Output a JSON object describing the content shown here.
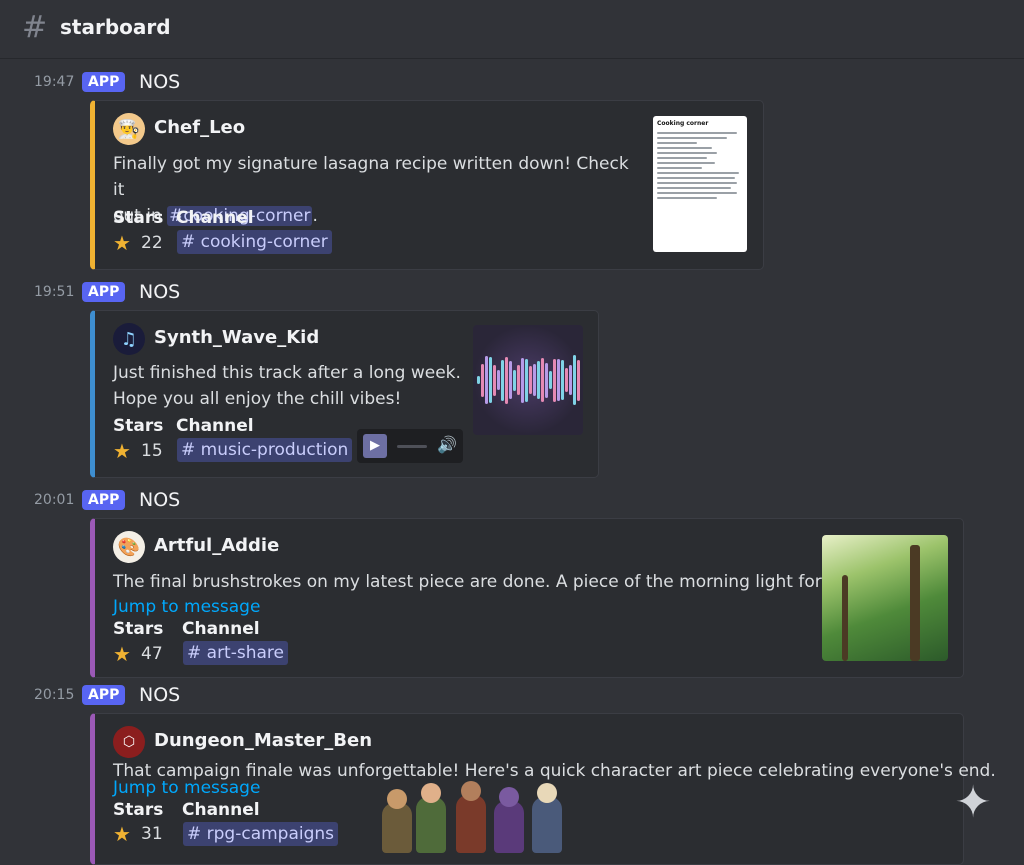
{
  "channel": {
    "name": "starboard"
  },
  "messages": [
    {
      "time": "19:47",
      "badge": "APP",
      "author": "NOS",
      "embed": {
        "username": "Chef_Leo",
        "text_before": "Finally got my signature lasagna recipe written down! Check it",
        "text_out_in": "out in",
        "mention": "#cooking-corner",
        "text_after": ".",
        "stars_label": "Stars",
        "channel_label": "Channel",
        "stars": "22",
        "channel": "# cooking-corner",
        "accent": "#f0b232",
        "avatar_icon": "chef-icon",
        "thumbnail_title": "Cooking corner"
      }
    },
    {
      "time": "19:51",
      "badge": "APP",
      "author": "NOS",
      "embed": {
        "username": "Synth_Wave_Kid",
        "line1": "Just finished this track after a long week.",
        "line2": "Hope you all enjoy the chill vibes!",
        "stars_label": "Stars",
        "channel_label": "Channel",
        "stars": "15",
        "channel": "# music-production",
        "accent": "#3e8ed0",
        "avatar_icon": "music-note-icon"
      }
    },
    {
      "time": "20:01",
      "badge": "APP",
      "author": "NOS",
      "embed": {
        "username": "Artful_Addie",
        "text": "The final brushstrokes on my latest piece are done. A piece of the morning light for everyone.",
        "jump": "Jump to message",
        "stars_label": "Stars",
        "channel_label": "Channel",
        "stars": "47",
        "channel": "# art-share",
        "accent": "#9b59b6",
        "avatar_icon": "palette-icon"
      }
    },
    {
      "time": "20:15",
      "badge": "APP",
      "author": "NOS",
      "embed": {
        "username": "Dungeon_Master_Ben",
        "text": "That campaign finale was unforgettable! Here's a quick character art piece celebrating everyone's end.",
        "jump": "Jump to message",
        "stars_label": "Stars",
        "channel_label": "Channel",
        "stars": "31",
        "channel": "# rpg-campaigns",
        "accent": "#9b59b6",
        "avatar_icon": "d20-icon"
      }
    }
  ],
  "colors": {
    "background": "#313338",
    "embed_bg": "#2b2d31",
    "app_badge": "#5865f2",
    "link": "#00a8fc",
    "star": "#f0b232"
  }
}
